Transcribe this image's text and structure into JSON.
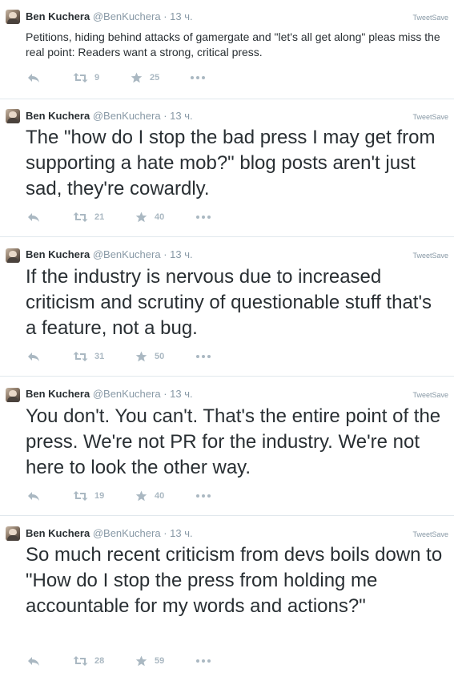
{
  "brand_label": "TweetSave",
  "author": {
    "name": "Ben Kuchera",
    "handle": "@BenKuchera",
    "separator": "·",
    "time": "13 ч."
  },
  "tweets": [
    {
      "text": "Petitions, hiding behind attacks of gamergate and \"let's all get along\" pleas miss the real point: Readers want a strong, critical press.",
      "retweets": "9",
      "favorites": "25"
    },
    {
      "text": "The \"how do I stop the bad press I may get from supporting a hate mob?\" blog posts aren't just sad, they're cowardly.",
      "retweets": "21",
      "favorites": "40"
    },
    {
      "text": "If the industry is nervous due to increased criticism and scrutiny of questionable stuff that's a feature, not a bug.",
      "retweets": "31",
      "favorites": "50"
    },
    {
      "text": "You don't. You can't. That's the entire point of the press. We're not PR for the industry. We're not here to look the other way.",
      "retweets": "19",
      "favorites": "40"
    },
    {
      "text": "So much recent criticism from devs boils down to \"How do I stop the press from holding me accountable for my words and actions?\"",
      "retweets": "28",
      "favorites": "59"
    }
  ],
  "icons": {
    "reply": "reply-icon",
    "retweet": "retweet-icon",
    "favorite": "star-icon",
    "more": "more-icon"
  },
  "colors": {
    "text": "#292f33",
    "muted": "#8899a6",
    "action": "#aab8c2",
    "divider": "#e1e8ed"
  }
}
